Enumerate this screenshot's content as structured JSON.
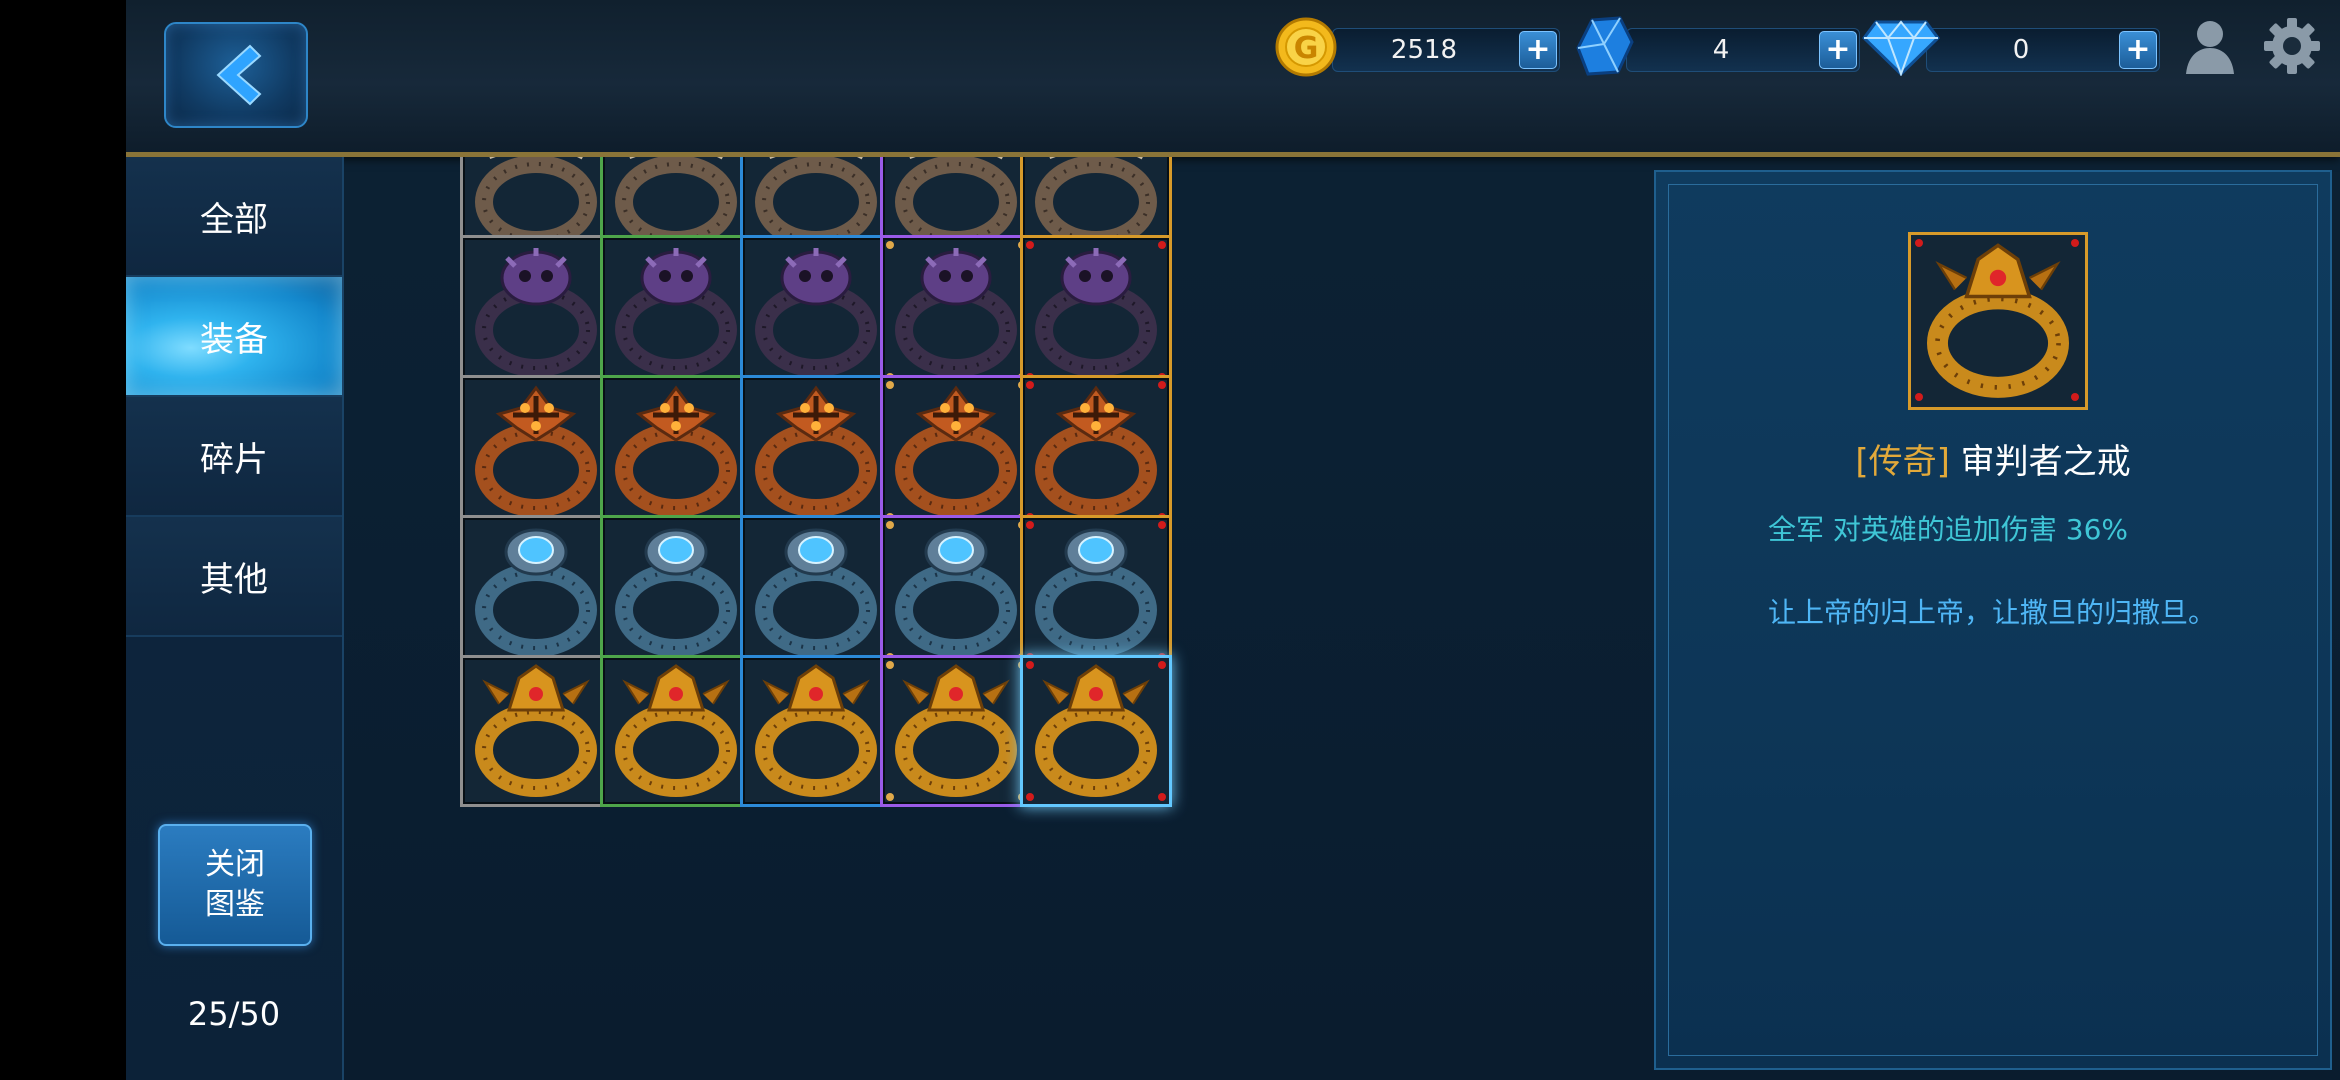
{
  "resources": {
    "gold": {
      "icon": "gold-coin-icon",
      "value": "2518"
    },
    "crystal": {
      "icon": "blue-crystal-icon",
      "value": "4"
    },
    "diamond": {
      "icon": "diamond-icon",
      "value": "0"
    },
    "plus_label": "+"
  },
  "sidebar": {
    "tabs": [
      {
        "label": "全部",
        "active": false
      },
      {
        "label": "装备",
        "active": true
      },
      {
        "label": "碎片",
        "active": false
      },
      {
        "label": "其他",
        "active": false
      }
    ],
    "close_button": {
      "line1": "关闭",
      "line2": "图鉴"
    },
    "counter": "25/50"
  },
  "grid": {
    "quality_colors": {
      "white": "#8f8f8f",
      "green": "#4ea54a",
      "blue": "#2c8ad8",
      "purple": "#9a5be8",
      "orange": "#d79a2a"
    },
    "rows": [
      {
        "ring": "thorn-crown-ring",
        "qualities": [
          "white",
          "green",
          "blue",
          "purple",
          "orange"
        ]
      },
      {
        "ring": "dark-skull-ring",
        "qualities": [
          "white",
          "green",
          "blue",
          "purple",
          "orange"
        ]
      },
      {
        "ring": "flame-cross-ring",
        "qualities": [
          "white",
          "green",
          "blue",
          "purple",
          "orange"
        ]
      },
      {
        "ring": "sapphire-ring",
        "qualities": [
          "white",
          "green",
          "blue",
          "purple",
          "orange"
        ]
      },
      {
        "ring": "judge-ring",
        "qualities": [
          "white",
          "green",
          "blue",
          "purple",
          "orange"
        ],
        "selected_index": 4
      }
    ]
  },
  "detail": {
    "icon": "judge-ring",
    "rarity": "[传奇]",
    "name": "审判者之戒",
    "stat": "全军 对英雄的追加伤害 36%",
    "desc": "让上帝的归上帝，让撒旦的归撒旦。"
  }
}
